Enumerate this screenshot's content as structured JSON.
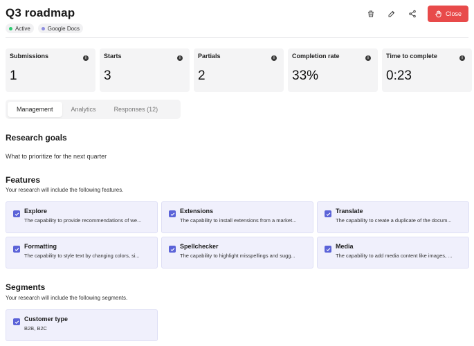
{
  "header": {
    "title": "Q3 roadmap",
    "badges": [
      {
        "label": "Active",
        "color": "#2ecc71"
      },
      {
        "label": "Google Docs",
        "color": "#8e8ee0"
      }
    ],
    "close_label": "Close",
    "icons": [
      "trash-icon",
      "edit-icon",
      "share-icon",
      "hand-icon"
    ]
  },
  "stats": [
    {
      "label": "Submissions",
      "value": "1"
    },
    {
      "label": "Starts",
      "value": "3"
    },
    {
      "label": "Partials",
      "value": "2"
    },
    {
      "label": "Completion rate",
      "value": "33%"
    },
    {
      "label": "Time to complete",
      "value": "0:23"
    }
  ],
  "tabs": [
    {
      "label": "Management",
      "active": true
    },
    {
      "label": "Analytics",
      "active": false
    },
    {
      "label": "Responses (12)",
      "active": false
    }
  ],
  "research_goals": {
    "heading": "Research goals",
    "text": "What to prioritize for the next quarter"
  },
  "features": {
    "heading": "Features",
    "description": "Your research will include the following features.",
    "items": [
      {
        "title": "Explore",
        "desc": "The capability to provide recommendations of we..."
      },
      {
        "title": "Extensions",
        "desc": "The capability to install extensions from a market..."
      },
      {
        "title": "Translate",
        "desc": "The capability to create a duplicate of the docum..."
      },
      {
        "title": "Formatting",
        "desc": "The capability to style text by changing colors, si..."
      },
      {
        "title": "Spellchecker",
        "desc": "The capability to highlight misspellings and sugg..."
      },
      {
        "title": "Media",
        "desc": "The capability to add media content like images, ..."
      }
    ]
  },
  "segments": {
    "heading": "Segments",
    "description": "Your research will include the following segments.",
    "items": [
      {
        "title": "Customer type",
        "desc": "B2B, B2C"
      }
    ]
  },
  "colors": {
    "accent": "#5b63d8",
    "close": "#e84a4a",
    "card_bg": "#f0f0fc"
  }
}
